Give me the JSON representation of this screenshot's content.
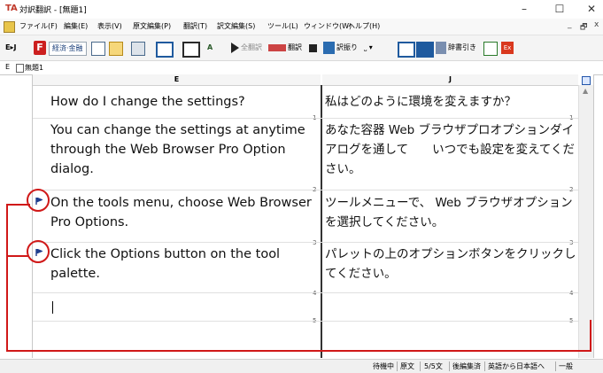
{
  "window": {
    "title": "対訳翻訳 - [無題1]",
    "controls": {
      "minimize": "–",
      "maximize": "☐",
      "close": "✕"
    }
  },
  "menubar": {
    "items": [
      "ファイル(F)",
      "編集(E)",
      "表示(V)",
      "原文編集(P)",
      "翻訳(T)",
      "訳文編集(S)",
      "ツール(L)",
      "ウィンドウ(W)",
      "ヘルプ(H)"
    ],
    "mdi_controls": [
      "_",
      "🗗",
      "x"
    ]
  },
  "toolbar": {
    "direction": "E▸J",
    "mode_dropdown": "経済·金融",
    "translate_all": "全翻訳",
    "translate": "翻訳",
    "retranslate": "訳振り",
    "dictionary": "辞書引き",
    "icons": [
      "F-button",
      "new-document-icon",
      "open-icon",
      "print-icon",
      "layout-icon",
      "columns-icon",
      "font-icon",
      "play-icon",
      "stop-icon",
      "retranslate-icon",
      "blank-icon",
      "split-vertical-icon",
      "split-horizontal-icon",
      "dictionary-icon",
      "notes-icon",
      "exit-icon"
    ]
  },
  "tabbar": {
    "label": "E",
    "document": "無題1"
  },
  "columns": {
    "source": "E",
    "target": "J"
  },
  "rows": [
    {
      "num": "1",
      "en": "How do I change the settings?",
      "ja": "私はどのように環境を変えますか？",
      "flag": false
    },
    {
      "num": "2",
      "en": "You can change the settings at anytime through the Web Browser Pro Option dialog.",
      "ja": "あなた容器 Web ブラウザプロオプションダイアログを通して　　いつでも設定を変えてください。",
      "flag": false
    },
    {
      "num": "3",
      "en": "On the tools menu, choose Web Browser Pro Options.",
      "ja": "ツールメニューで、 Web ブラウザオプションを選択してください。",
      "flag": true
    },
    {
      "num": "4",
      "en": "Click the Options button on the tool palette.",
      "ja": "パレットの上のオプションボタンをクリックしてください。",
      "flag": true
    },
    {
      "num": "5",
      "en": "",
      "ja": "",
      "flag": false
    }
  ],
  "statusbar": {
    "items": [
      "待機中",
      "原文",
      "5/5文",
      "後編集済",
      "英語から日本語へ",
      "一般"
    ]
  },
  "colors": {
    "highlight": "#d01818",
    "flag": "#1f3f8f"
  }
}
